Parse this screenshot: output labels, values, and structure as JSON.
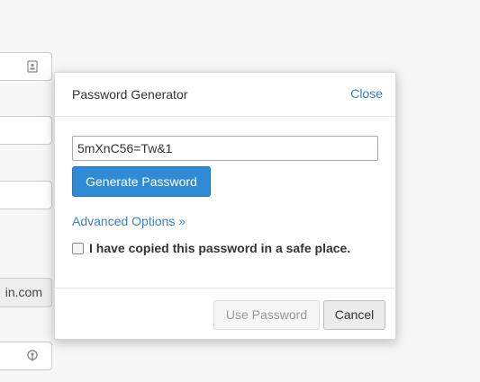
{
  "background": {
    "addon_text": "in.com",
    "icons": [
      "id-card-icon",
      "key-icon"
    ]
  },
  "popover": {
    "title": "Password Generator",
    "close_label": "Close",
    "password_value": "5mXnC56=Tw&1",
    "generate_label": "Generate Password",
    "advanced_label": "Advanced Options »",
    "checkbox_label": "I have copied this password in a safe place.",
    "checkbox_checked": false,
    "use_label": "Use Password",
    "cancel_label": "Cancel"
  },
  "colors": {
    "primary": "#2f8bd6",
    "link": "#3b7fc4"
  }
}
